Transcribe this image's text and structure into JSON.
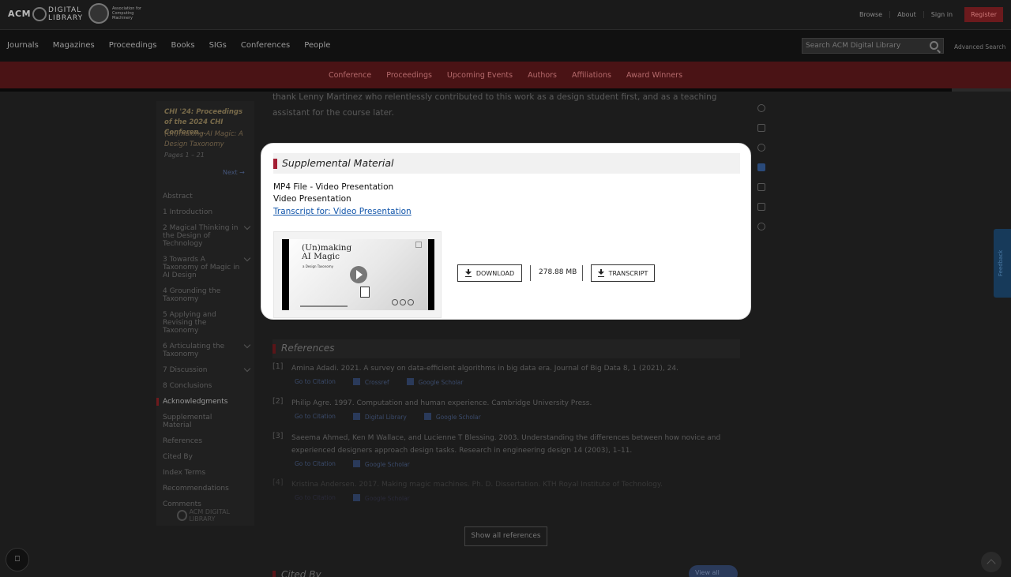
{
  "header": {
    "logo_acm": "ACM",
    "logo_dl": "DIGITAL LIBRARY",
    "assoc_text": "Association for Computing Machinery",
    "links": [
      "Browse",
      "About",
      "Sign in"
    ],
    "register": "Register"
  },
  "mainnav": {
    "items": [
      "Journals",
      "Magazines",
      "Proceedings",
      "Books",
      "SIGs",
      "Conferences",
      "People"
    ],
    "search_placeholder": "Search ACM Digital Library",
    "advanced": "Advanced Search"
  },
  "subnav": {
    "items": [
      "Conference",
      "Proceedings",
      "Upcoming Events",
      "Authors",
      "Affiliations",
      "Award Winners"
    ]
  },
  "sidebar": {
    "proceedings": "CHI '24: Proceedings of the 2024 CHI Conferen...",
    "paper": "(Un)making AI Magic: A Design Taxonomy",
    "pages": "Pages 1 – 21",
    "next": "Next →",
    "toc": [
      {
        "label": "Abstract",
        "chev": false
      },
      {
        "label": "1 Introduction",
        "chev": false
      },
      {
        "label": "2 Magical Thinking in the Design of Technology",
        "chev": true
      },
      {
        "label": "3 Towards A Taxonomy of Magic in AI Design",
        "chev": true
      },
      {
        "label": "4 Grounding the Taxonomy",
        "chev": false
      },
      {
        "label": "5 Applying and Revising the Taxonomy",
        "chev": false
      },
      {
        "label": "6 Articulating the Taxonomy",
        "chev": true
      },
      {
        "label": "7 Discussion",
        "chev": true
      },
      {
        "label": "8 Conclusions",
        "chev": false
      },
      {
        "label": "Acknowledgments",
        "chev": false,
        "active": true
      },
      {
        "label": "Supplemental Material",
        "chev": false
      },
      {
        "label": "References",
        "chev": false
      },
      {
        "label": "Cited By",
        "chev": false
      },
      {
        "label": "Index Terms",
        "chev": false
      },
      {
        "label": "Recommendations",
        "chev": false
      },
      {
        "label": "Comments",
        "chev": false
      }
    ],
    "footer_logo": "ACM DIGITAL LIBRARY"
  },
  "article": {
    "ack_text": "thank Lenny Martinez who relentlessly contributed to this work as a design student first, and as a teaching assistant for the course later."
  },
  "references": {
    "heading": "References",
    "items": [
      {
        "num": "[1]",
        "text": "Amina Adadi. 2021. A survey on data-efficient algorithms in big data era. Journal of Big Data 8, 1 (2021), 24.",
        "links": [
          "Go to Citation",
          "Crossref",
          "Google Scholar"
        ]
      },
      {
        "num": "[2]",
        "text": "Philip Agre. 1997. Computation and human experience. Cambridge University Press.",
        "links": [
          "Go to Citation",
          "Digital Library",
          "Google Scholar"
        ]
      },
      {
        "num": "[3]",
        "text": "Saeema Ahmed, Ken M Wallace, and Lucienne T Blessing. 2003. Understanding the differences between how novice and experienced designers approach design tasks. Research in engineering design 14 (2003), 1–11.",
        "links": [
          "Go to Citation",
          "Google Scholar"
        ]
      },
      {
        "num": "[4]",
        "text": "Kristina Andersen. 2017. Making magic machines. Ph. D. Dissertation. KTH Royal Institute of Technology.",
        "links": [
          "Go to Citation",
          "Google Scholar"
        ]
      }
    ],
    "show_all": "Show all references"
  },
  "cited_by": {
    "heading": "Cited By",
    "view_all": "View all"
  },
  "feedback": "Feedback",
  "modal": {
    "heading": "Supplemental Material",
    "file_title": "MP4 File - Video Presentation",
    "file_sub": "Video Presentation",
    "transcript_link": "Transcript for: Video Presentation",
    "video": {
      "title": "(Un)making AI Magic",
      "subtitle": "a Design Taxonomy"
    },
    "download": "DOWNLOAD",
    "size": "278.88 MB",
    "transcript": "TRANSCRIPT"
  }
}
